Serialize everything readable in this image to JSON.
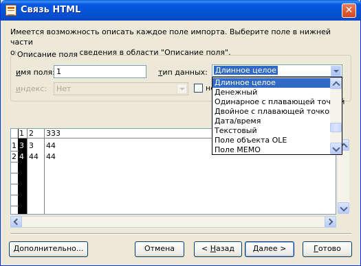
{
  "window": {
    "title": "Связь HTML",
    "close_glyph": "✕"
  },
  "description": {
    "line1": "Имеется возможность описать каждое поле импорта.  Выберите поле в нижней части",
    "line2": "окна и измените сведения в области \"Описание поля\"."
  },
  "field_desc": {
    "group_label": "Описание поля",
    "name_label_u": "и",
    "name_label_rest": "мя поля:",
    "name_value": "1",
    "type_label_u": "т",
    "type_label_rest": "ип данных:",
    "type_value": "Длинное целое",
    "index_label_u": "и",
    "index_label_rest": "ндекс:",
    "index_value": "Нет",
    "skip_label": "не"
  },
  "dropdown": {
    "options": [
      "Длинное целое",
      "Денежный",
      "Одинарное с плавающей точкой",
      "Двойное с плавающей точкой",
      "Дата/время",
      "Текстовый",
      "Поле объекта OLE",
      "Поле MEMO"
    ],
    "selected_index": 0
  },
  "grid": {
    "headers": [
      "1",
      "2",
      "333"
    ],
    "rows": [
      {
        "num": "1",
        "cells": [
          "3",
          "3",
          "44"
        ]
      },
      {
        "num": "2",
        "cells": [
          "4",
          "44",
          "44"
        ]
      }
    ]
  },
  "buttons": {
    "advanced": "Дополнительно...",
    "cancel": "Отмена",
    "back_prefix": "< ",
    "back_u": "Н",
    "back_rest": "азад",
    "next_u": "Д",
    "next_rest": "алее >",
    "finish_u": "Г",
    "finish_rest": "отово"
  },
  "colors": {
    "title_bar": "#0453d6",
    "selection": "#316ac5",
    "face": "#ece9d8"
  }
}
